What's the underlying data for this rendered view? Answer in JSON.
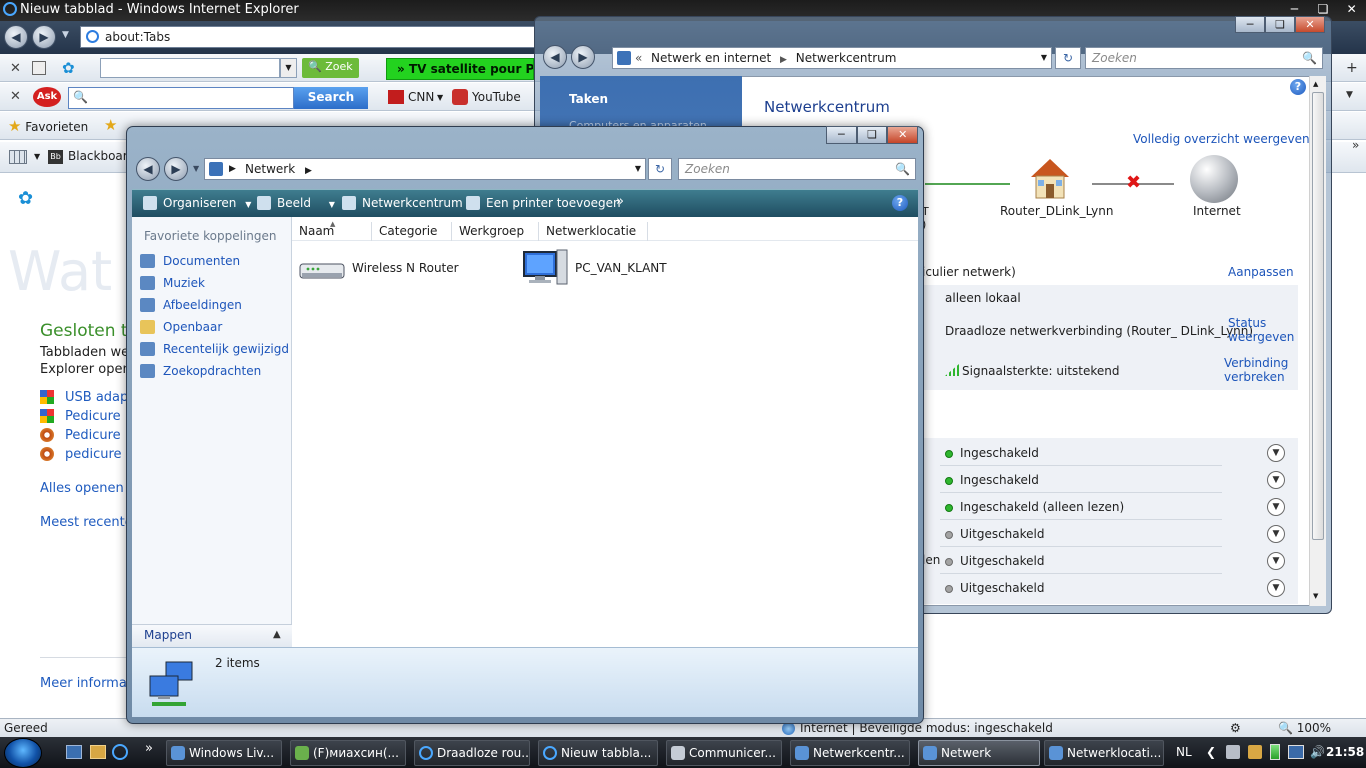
{
  "ie": {
    "title": "Nieuw tabblad - Windows Internet Explorer",
    "address": "about:Tabs",
    "toolbar1": {
      "zoek_label": "Zoek",
      "tv_banner": "» TV satellite pour PC"
    },
    "toolbar2": {
      "search_label": "Search",
      "cnn_label": "CNN",
      "youtube_label": "YouTube"
    },
    "favorites": {
      "label": "Favorieten",
      "blackboard": "Blackboard"
    },
    "content": {
      "watermark": "Wat",
      "heading": "Gesloten ta",
      "text1": "Tabbladen we",
      "text2": "Explorer open",
      "links": [
        "USB adapt",
        "Pedicure H",
        "Pedicure H",
        "pedicure i"
      ],
      "alles_openen": "Alles openen",
      "meest_recente": "Meest recente",
      "meer_informatie": "Meer informat"
    },
    "status": {
      "left": "Gereed",
      "zone": "Internet | Beveiligde modus: ingeschakeld",
      "zoom": "100%"
    }
  },
  "netcenter": {
    "breadcrumb": [
      "Netwerk en internet",
      "Netwerkcentrum"
    ],
    "search_placeholder": "Zoeken",
    "tasks_title": "Taken",
    "tasks_item": "Computers en apparaten weergeven",
    "heading": "Netwerkcentrum",
    "full_view": "Volledig overzicht weergeven",
    "router_label": "Router_DLink_Lynn",
    "internet_label": "Internet",
    "partial_left1": "T",
    "partial_left2": ")",
    "private_network": "iculier netwerk)",
    "customize": "Aanpassen",
    "access": "alleen lokaal",
    "connection": "Draadloze netwerkverbinding (Router_ DLink_Lynn)",
    "status_link": "Status weergeven",
    "signal": "Signaalsterkte: uitstekend",
    "disconnect_link": "Verbinding verbreken",
    "sharing_partial": "len",
    "sharing_rows": [
      {
        "status": "Ingeschakeld",
        "on": true
      },
      {
        "status": "Ingeschakeld",
        "on": true
      },
      {
        "status": "Ingeschakeld (alleen lezen)",
        "on": true
      },
      {
        "status": "Uitgeschakeld",
        "on": false
      },
      {
        "status": "Uitgeschakeld",
        "on": false
      },
      {
        "status": "Uitgeschakeld",
        "on": false
      }
    ]
  },
  "explorer": {
    "breadcrumb": "Netwerk",
    "search_placeholder": "Zoeken",
    "commands": {
      "organize": "Organiseren",
      "view": "Beeld",
      "netcenter": "Netwerkcentrum",
      "add_printer": "Een printer toevoegen"
    },
    "nav_header": "Favoriete koppelingen",
    "nav_items": [
      "Documenten",
      "Muziek",
      "Afbeeldingen",
      "Openbaar",
      "Recentelijk gewijzigd",
      "Zoekopdrachten"
    ],
    "folders_label": "Mappen",
    "columns": [
      "Naam",
      "Categorie",
      "Werkgroep",
      "Netwerklocatie"
    ],
    "items": [
      "Wireless N Router",
      "PC_VAN_KLANT"
    ],
    "details_count": "2 items"
  },
  "taskbar": {
    "buttons": [
      "Windows Liv...",
      "(F)миахсин(...",
      "Draadloze rou...",
      "Nieuw tabbla...",
      "Communicer...",
      "Netwerkcentr...",
      "Netwerk",
      "Netwerklocati..."
    ],
    "active_index": 6,
    "language": "NL",
    "clock": "21:58"
  },
  "colors": {
    "link": "#1d55ba",
    "enabled_dot": "#2fb62f",
    "disabled_dot": "#a3a3a3",
    "banner_green": "#23d21f"
  }
}
